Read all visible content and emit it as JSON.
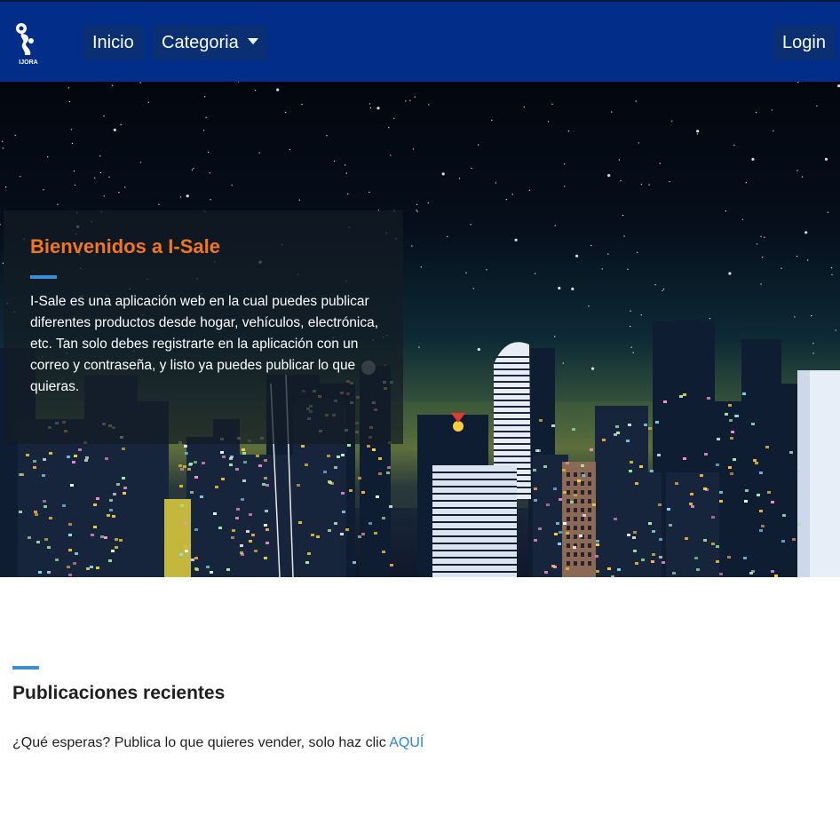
{
  "navbar": {
    "logo_text": "IJORA",
    "inicio_label": "Inicio",
    "categoria_label": "Categoria",
    "login_label": "Login",
    "background_color": "#022e8a"
  },
  "hero": {
    "title": "Bienvenidos a I-Sale",
    "description": "I-Sale es una aplicación web en la cual puedes publicar diferentes productos desde hogar, vehículos, electrónica, etc. Tan solo debes registrarte en la aplicación con un correo y contraseña, y listo ya puedes publicar lo que quieras.",
    "title_color": "#f2751f",
    "accent_color": "#3b8ed6"
  },
  "recent": {
    "title": "Publicaciones recientes",
    "prompt_text": "¿Qué esperas? Publica lo que quieres vender, solo haz clic ",
    "link_text": "AQUÍ",
    "link_color": "#2a86d9"
  },
  "icons": {
    "logo": "robot-logo-icon",
    "categoria_caret": "caret-down-icon"
  }
}
